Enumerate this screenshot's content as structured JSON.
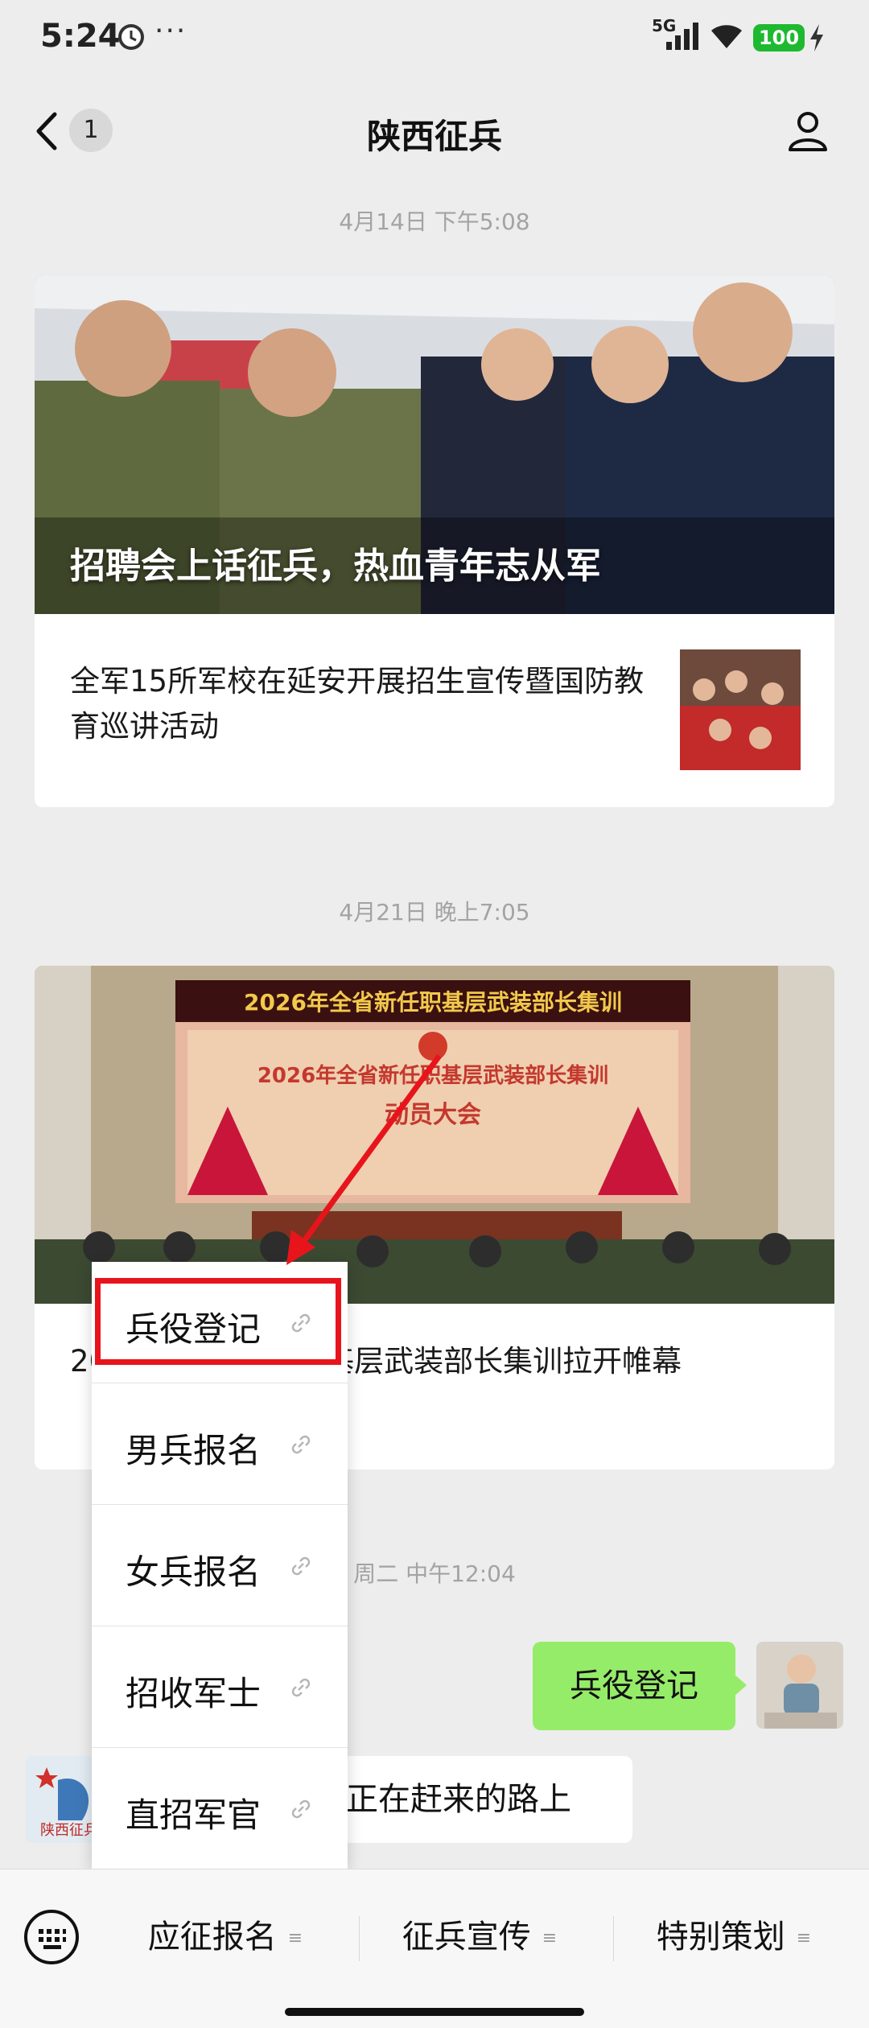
{
  "status_bar": {
    "time": "5:24",
    "more": "···",
    "network": "5G",
    "battery": "100"
  },
  "nav": {
    "back_badge": "1",
    "title": "陕西征兵"
  },
  "feed": [
    {
      "timestamp": "4月14日 下午5:08",
      "cover_caption": "招聘会上话征兵，热血青年志从军",
      "sub_title": "全军15所军校在延安开展招生宣传暨国防教育巡讲活动"
    },
    {
      "timestamp": "4月21日 晚上7:05",
      "banner_text": "2026年全省新任职基层武装部长集训",
      "screen_text_1": "2026年全省新任职基层武装部长集训",
      "screen_text_2": "动员大会",
      "sub_title": "2026年全省新任职基层武装部长集训拉开帷幕"
    }
  ],
  "chat": {
    "timestamp": "周二 中午12:04",
    "user_message": "兵役登记",
    "official_name_short": "陕西征兵",
    "official_reply": "正在赶来的路上"
  },
  "popup_menu": {
    "items": [
      "兵役登记",
      "男兵报名",
      "女兵报名",
      "招收军士",
      "直招军官"
    ],
    "highlighted_index": 0
  },
  "bottom_menu": {
    "items": [
      "应征报名",
      "征兵宣传",
      "特别策划"
    ],
    "eq_glyph": "≡"
  },
  "colors": {
    "highlight": "#e8141c",
    "bubble_green": "#95ec69",
    "battery_green": "#1fb931"
  }
}
